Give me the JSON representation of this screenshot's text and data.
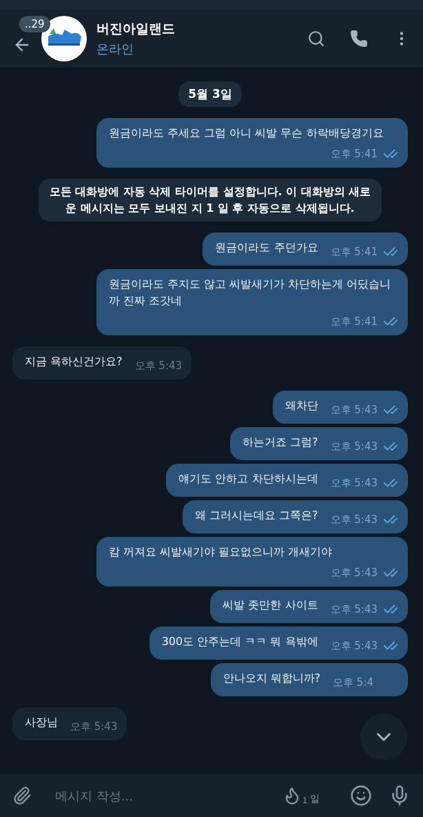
{
  "header": {
    "unread_badge": "..29",
    "title": "버진아일랜드",
    "status": "온라인"
  },
  "messages": [
    {
      "kind": "date",
      "text": "5월 3일"
    },
    {
      "kind": "out",
      "text": "원금이라도 주세요 그럼 아니 씨발 무슨 하락배당경기요",
      "time": "오후 5:41",
      "read": true
    },
    {
      "kind": "service",
      "text": "모든 대화방에 자동 삭제 타이머를 설정합니다. 이 대화방의 새로운 메시지는 모두 보내진 지 1 일 후 자동으로 삭제됩니다."
    },
    {
      "kind": "out",
      "text": "원금이라도 주던가요",
      "time": "오후 5:41",
      "read": true
    },
    {
      "kind": "out",
      "text": "원금이라도 주지도 않고 씨발새기가 차단하는게 어딨습니까 진짜 조갓네",
      "time": "오후 5:41",
      "read": true
    },
    {
      "kind": "in",
      "text": "지금 욕하신건가요?",
      "time": "오후 5:43"
    },
    {
      "kind": "out",
      "text": "왜차단",
      "time": "오후 5:43",
      "read": true
    },
    {
      "kind": "out",
      "text": "하는거죠 그럼?",
      "time": "오후 5:43",
      "read": true
    },
    {
      "kind": "out",
      "text": "얘기도 안하고 차단하시는데",
      "time": "오후 5:43",
      "read": true
    },
    {
      "kind": "out",
      "text": "왜 그러시는데요 그쪽은?",
      "time": "오후 5:43",
      "read": true
    },
    {
      "kind": "out",
      "text": "캄 꺼져요 씨발새기야 필요없으니까 개새기야",
      "time": "오후 5:43",
      "read": true
    },
    {
      "kind": "out",
      "text": "씨발 좃만한 사이트",
      "time": "오후 5:43",
      "read": true
    },
    {
      "kind": "out",
      "text": "300도 안주는데 ㅋㅋ 뭐 욕밖에",
      "time": "오후 5:43",
      "read": true
    },
    {
      "kind": "out",
      "text": "안나오지 뭐합니까?",
      "time": "오후 5:4"
    },
    {
      "kind": "in",
      "text": "사장님",
      "time": "오후 5:43"
    }
  ],
  "composer": {
    "placeholder": "메시지 작성...",
    "timer_count": "1",
    "timer_unit": "일"
  }
}
